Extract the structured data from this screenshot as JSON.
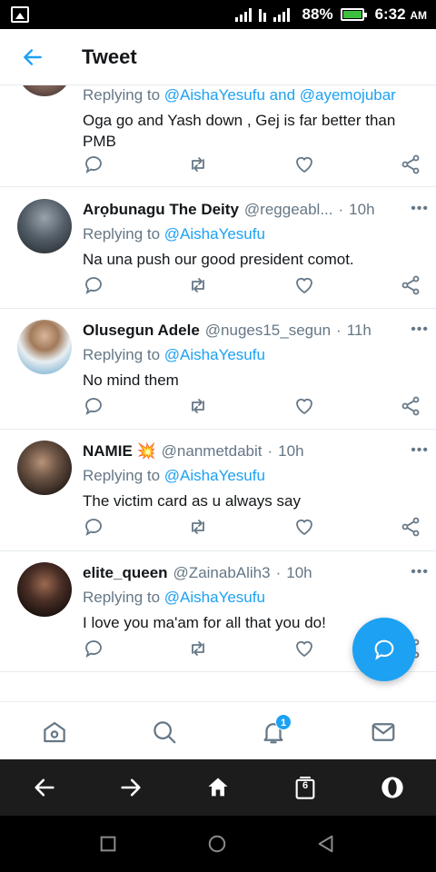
{
  "status_bar": {
    "battery": "88%",
    "time": "6:32",
    "ampm": "AM"
  },
  "header": {
    "title": "Tweet",
    "back_icon": "arrow-left-icon"
  },
  "tweets": [
    {
      "name": "",
      "handle": "",
      "time": "",
      "replying_prefix": "Replying to",
      "replying_to": "@AishaYesufu and @ayemojubar",
      "text": "Oga go and Yash down , Gej is far better than PMB"
    },
    {
      "name": "Arọbunagu The Deity",
      "handle": "@reggeabl...",
      "time": "10h",
      "replying_prefix": "Replying to",
      "replying_to": "@AishaYesufu",
      "text": "Na una push our good president comot."
    },
    {
      "name": "Olusegun Adele",
      "handle": "@nuges15_segun",
      "time": "11h",
      "replying_prefix": "Replying to",
      "replying_to": "@AishaYesufu",
      "text": "No mind them"
    },
    {
      "name": "NAMIE 💥",
      "handle": "@nanmetdabit",
      "time": "10h",
      "replying_prefix": "Replying to",
      "replying_to": "@AishaYesufu",
      "text": "The victim card as u always say"
    },
    {
      "name": "elite_queen",
      "handle": "@ZainabAlih3",
      "time": "10h",
      "replying_prefix": "Replying to",
      "replying_to": "@AishaYesufu",
      "text": "I love you ma'am for all that you do!"
    }
  ],
  "notification_badge": "1",
  "tab_count": "6",
  "colors": {
    "accent": "#1da1f2",
    "muted": "#657786",
    "text": "#14171a"
  }
}
